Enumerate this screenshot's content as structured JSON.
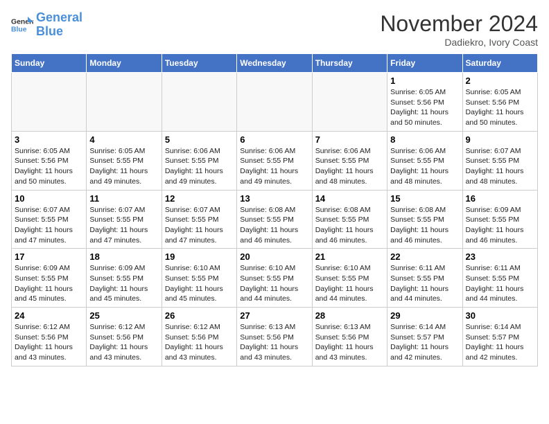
{
  "header": {
    "logo_line1": "General",
    "logo_line2": "Blue",
    "month_title": "November 2024",
    "location": "Dadiekro, Ivory Coast"
  },
  "weekdays": [
    "Sunday",
    "Monday",
    "Tuesday",
    "Wednesday",
    "Thursday",
    "Friday",
    "Saturday"
  ],
  "weeks": [
    [
      {
        "day": "",
        "info": ""
      },
      {
        "day": "",
        "info": ""
      },
      {
        "day": "",
        "info": ""
      },
      {
        "day": "",
        "info": ""
      },
      {
        "day": "",
        "info": ""
      },
      {
        "day": "1",
        "info": "Sunrise: 6:05 AM\nSunset: 5:56 PM\nDaylight: 11 hours\nand 50 minutes."
      },
      {
        "day": "2",
        "info": "Sunrise: 6:05 AM\nSunset: 5:56 PM\nDaylight: 11 hours\nand 50 minutes."
      }
    ],
    [
      {
        "day": "3",
        "info": "Sunrise: 6:05 AM\nSunset: 5:56 PM\nDaylight: 11 hours\nand 50 minutes."
      },
      {
        "day": "4",
        "info": "Sunrise: 6:05 AM\nSunset: 5:55 PM\nDaylight: 11 hours\nand 49 minutes."
      },
      {
        "day": "5",
        "info": "Sunrise: 6:06 AM\nSunset: 5:55 PM\nDaylight: 11 hours\nand 49 minutes."
      },
      {
        "day": "6",
        "info": "Sunrise: 6:06 AM\nSunset: 5:55 PM\nDaylight: 11 hours\nand 49 minutes."
      },
      {
        "day": "7",
        "info": "Sunrise: 6:06 AM\nSunset: 5:55 PM\nDaylight: 11 hours\nand 48 minutes."
      },
      {
        "day": "8",
        "info": "Sunrise: 6:06 AM\nSunset: 5:55 PM\nDaylight: 11 hours\nand 48 minutes."
      },
      {
        "day": "9",
        "info": "Sunrise: 6:07 AM\nSunset: 5:55 PM\nDaylight: 11 hours\nand 48 minutes."
      }
    ],
    [
      {
        "day": "10",
        "info": "Sunrise: 6:07 AM\nSunset: 5:55 PM\nDaylight: 11 hours\nand 47 minutes."
      },
      {
        "day": "11",
        "info": "Sunrise: 6:07 AM\nSunset: 5:55 PM\nDaylight: 11 hours\nand 47 minutes."
      },
      {
        "day": "12",
        "info": "Sunrise: 6:07 AM\nSunset: 5:55 PM\nDaylight: 11 hours\nand 47 minutes."
      },
      {
        "day": "13",
        "info": "Sunrise: 6:08 AM\nSunset: 5:55 PM\nDaylight: 11 hours\nand 46 minutes."
      },
      {
        "day": "14",
        "info": "Sunrise: 6:08 AM\nSunset: 5:55 PM\nDaylight: 11 hours\nand 46 minutes."
      },
      {
        "day": "15",
        "info": "Sunrise: 6:08 AM\nSunset: 5:55 PM\nDaylight: 11 hours\nand 46 minutes."
      },
      {
        "day": "16",
        "info": "Sunrise: 6:09 AM\nSunset: 5:55 PM\nDaylight: 11 hours\nand 46 minutes."
      }
    ],
    [
      {
        "day": "17",
        "info": "Sunrise: 6:09 AM\nSunset: 5:55 PM\nDaylight: 11 hours\nand 45 minutes."
      },
      {
        "day": "18",
        "info": "Sunrise: 6:09 AM\nSunset: 5:55 PM\nDaylight: 11 hours\nand 45 minutes."
      },
      {
        "day": "19",
        "info": "Sunrise: 6:10 AM\nSunset: 5:55 PM\nDaylight: 11 hours\nand 45 minutes."
      },
      {
        "day": "20",
        "info": "Sunrise: 6:10 AM\nSunset: 5:55 PM\nDaylight: 11 hours\nand 44 minutes."
      },
      {
        "day": "21",
        "info": "Sunrise: 6:10 AM\nSunset: 5:55 PM\nDaylight: 11 hours\nand 44 minutes."
      },
      {
        "day": "22",
        "info": "Sunrise: 6:11 AM\nSunset: 5:55 PM\nDaylight: 11 hours\nand 44 minutes."
      },
      {
        "day": "23",
        "info": "Sunrise: 6:11 AM\nSunset: 5:55 PM\nDaylight: 11 hours\nand 44 minutes."
      }
    ],
    [
      {
        "day": "24",
        "info": "Sunrise: 6:12 AM\nSunset: 5:56 PM\nDaylight: 11 hours\nand 43 minutes."
      },
      {
        "day": "25",
        "info": "Sunrise: 6:12 AM\nSunset: 5:56 PM\nDaylight: 11 hours\nand 43 minutes."
      },
      {
        "day": "26",
        "info": "Sunrise: 6:12 AM\nSunset: 5:56 PM\nDaylight: 11 hours\nand 43 minutes."
      },
      {
        "day": "27",
        "info": "Sunrise: 6:13 AM\nSunset: 5:56 PM\nDaylight: 11 hours\nand 43 minutes."
      },
      {
        "day": "28",
        "info": "Sunrise: 6:13 AM\nSunset: 5:56 PM\nDaylight: 11 hours\nand 43 minutes."
      },
      {
        "day": "29",
        "info": "Sunrise: 6:14 AM\nSunset: 5:57 PM\nDaylight: 11 hours\nand 42 minutes."
      },
      {
        "day": "30",
        "info": "Sunrise: 6:14 AM\nSunset: 5:57 PM\nDaylight: 11 hours\nand 42 minutes."
      }
    ]
  ]
}
